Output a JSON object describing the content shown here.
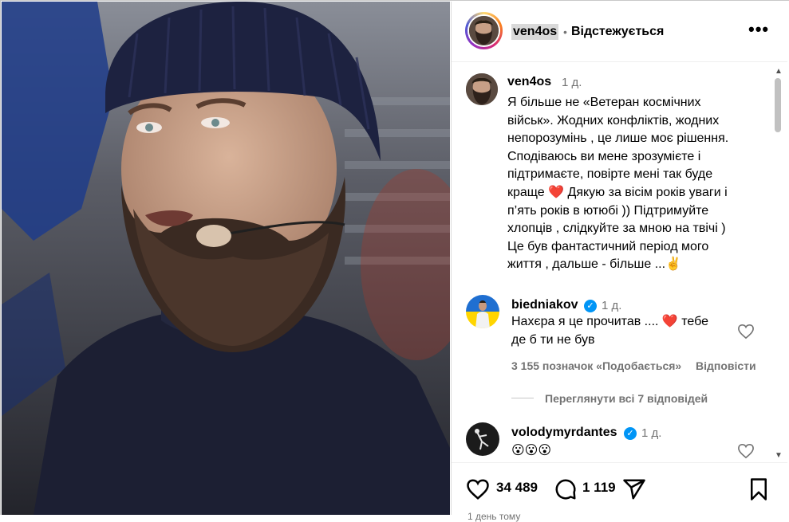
{
  "post_header": {
    "username": "ven4os",
    "separator": "•",
    "follow_label": "Відстежується",
    "more_label": "•••"
  },
  "caption": {
    "username": "ven4os",
    "time": "1 д.",
    "lines": [
      "Я більше не «Ветеран космічних",
      "військ». Жодних конфліктів, жодних",
      "непорозумінь , це лише моє рішення.",
      "Сподіваюсь ви мене зрозумієте і",
      "підтримаєте, повірте мені так буде",
      "краще ❤️ Дякую за вісім років уваги і",
      "п’ять років в ютюбі )) Підтримуйте",
      "хлопців , слідкуйте за мною на твічі )",
      "Це був фантастичний період мого",
      "життя , дальше - більше ...✌️"
    ]
  },
  "comments": [
    {
      "username": "biedniakov",
      "verified": true,
      "time": "1 д.",
      "lines": [
        "Нахєра я це прочитав .... ❤️ тебе",
        "де б ти не був"
      ],
      "likes": "3 155 позначок «Подобається»",
      "reply_label": "Відповісти",
      "view_replies": "Переглянути всі 7 відповідей"
    },
    {
      "username": "volodymyrdantes",
      "verified": true,
      "time": "1 д.",
      "lines": [
        "😮😮😮"
      ]
    }
  ],
  "actions": {
    "likes": "34 489",
    "comments": "1 119"
  },
  "footer": {
    "date": "1 день тому"
  },
  "icons": {
    "more": "more-icon",
    "like": "heart-icon",
    "comment": "comment-icon",
    "share": "share-icon",
    "save": "bookmark-icon",
    "verified": "verified-badge-icon"
  },
  "colors": {
    "verified": "#0095f6",
    "heart": "#ff3040",
    "muted": "#737373"
  }
}
